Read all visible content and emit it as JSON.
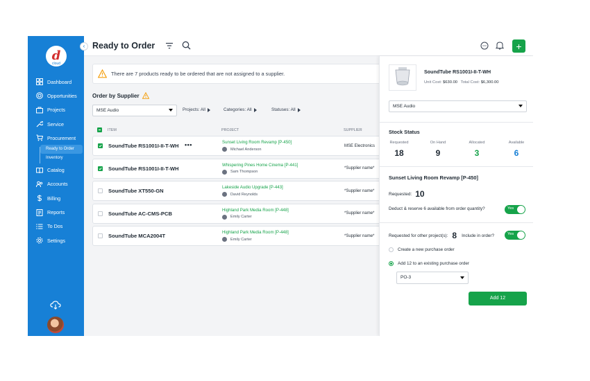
{
  "sidebar": {
    "logo_letter": "d",
    "logo_text": "cloud",
    "collapse_glyph": "‹",
    "items": [
      {
        "label": "Dashboard",
        "icon": "dashboard-icon"
      },
      {
        "label": "Opportunities",
        "icon": "target-icon"
      },
      {
        "label": "Projects",
        "icon": "projects-icon"
      },
      {
        "label": "Service",
        "icon": "wrench-icon"
      },
      {
        "label": "Procurement",
        "icon": "cart-icon"
      },
      {
        "label": "Catalog",
        "icon": "book-icon"
      },
      {
        "label": "Accounts",
        "icon": "users-icon"
      },
      {
        "label": "Billing",
        "icon": "dollar-icon"
      },
      {
        "label": "Reports",
        "icon": "reports-icon"
      },
      {
        "label": "To Dos",
        "icon": "list-icon"
      },
      {
        "label": "Settings",
        "icon": "gear-icon"
      }
    ],
    "subitems": [
      {
        "label": "Ready to Order",
        "active": true
      },
      {
        "label": "Inventory",
        "active": false
      }
    ]
  },
  "header": {
    "title": "Ready to Order",
    "add_glyph": "+"
  },
  "alert": {
    "message": "There are 7 products ready to be ordered that are not assigned to a supplier."
  },
  "order": {
    "title": "Order by Supplier",
    "supplier_value": "MSE Audio",
    "filters": {
      "projects": "Projects: All",
      "categories": "Categories: All",
      "statuses": "Statuses: All"
    }
  },
  "table": {
    "headers": {
      "item": "ITEM",
      "project": "PROJECT",
      "supplier": "SUPPLIER"
    },
    "more_glyph": "•••",
    "rows": [
      {
        "item": "SoundTube RS1001I-II-T-WH",
        "project": "Sunset Living Room Revamp [P-450]",
        "person": "Michael Anderson",
        "supplier": "MSE Electronics",
        "checked": true
      },
      {
        "item": "SoundTube RS1001I-II-T-WH",
        "project": "Whispering Pines Home Cinema [P-441]",
        "person": "Sam Thompson",
        "supplier": "*Supplier name*",
        "checked": true
      },
      {
        "item": "SoundTube XT550-GN",
        "project": "Lakeside Audio Upgrade [P-443]",
        "person": "David Reynolds",
        "supplier": "*Supplier name*",
        "checked": false
      },
      {
        "item": "SoundTube AC-CMS-PCB",
        "project": "Highland Park Media Room [P-448]",
        "person": "Emily Carter",
        "supplier": "*Supplier name*",
        "checked": false
      },
      {
        "item": "SoundTube MCA2004T",
        "project": "Highland Park Media Room [P-448]",
        "person": "Emily Carter",
        "supplier": "*Supplier name*",
        "checked": false
      }
    ]
  },
  "panel": {
    "product_name": "SoundTube RS1001I-II-T-WH",
    "unit_cost_label": "Unit Cost:",
    "unit_cost": "$630.00",
    "total_cost_label": "Total Cost:",
    "total_cost": "$6,300.00",
    "supplier_value": "MSE Audio",
    "stock_title": "Stock Status",
    "stats": [
      {
        "label": "Requested",
        "value": "18",
        "color": "#1f2933"
      },
      {
        "label": "On Hand",
        "value": "9",
        "color": "#1f2933"
      },
      {
        "label": "Allocated",
        "value": "3",
        "color": "#16a34a"
      },
      {
        "label": "Available",
        "value": "6",
        "color": "#1780d6"
      }
    ],
    "project_title": "Sunset Living Room Revamp [P-450]",
    "requested_label": "Requested:",
    "requested_value": "10",
    "deduct_label": "Deduct & reserve 6 available from order quantity?",
    "toggle_yes": "Yes",
    "other_label": "Requested for other project(s):",
    "other_value": "8",
    "include_label": "Include in order?",
    "create_po_label": "Create a new purchase order",
    "add_existing_label": "Add 12 to an existing purchase order",
    "po_value": "PO-3",
    "add_button": "Add 12"
  },
  "colors": {
    "sidebar": "#1780d6",
    "accent_green": "#16a34a",
    "available_blue": "#1780d6",
    "warning": "#f59e0b"
  }
}
